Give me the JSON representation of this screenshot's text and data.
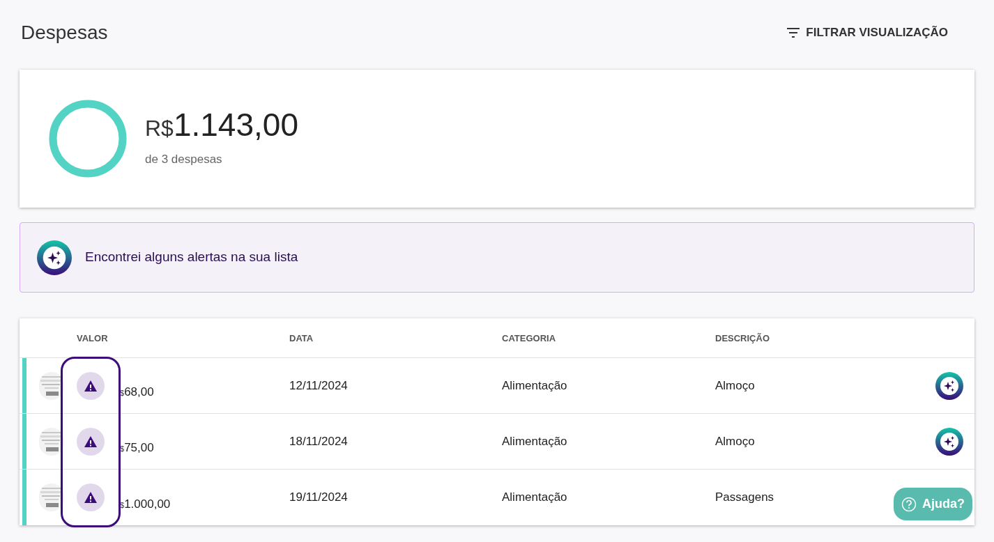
{
  "page": {
    "title": "Despesas",
    "filter_button": "FILTRAR VISUALIZAÇÃO"
  },
  "summary": {
    "currency": "R$",
    "total": "1.143,00",
    "caption": "de 3 despesas"
  },
  "alert_banner": {
    "text": "Encontrei alguns alertas na sua lista"
  },
  "table": {
    "columns": [
      "VALOR",
      "DATA",
      "CATEGORIA",
      "DESCRIÇÃO"
    ],
    "rows": [
      {
        "alert": true,
        "currency": "$",
        "value": "68,00",
        "date": "12/11/2024",
        "category": "Alimentação",
        "description": "Almoço"
      },
      {
        "alert": true,
        "currency": "$",
        "value": "75,00",
        "date": "18/11/2024",
        "category": "Alimentação",
        "description": "Almoço"
      },
      {
        "alert": true,
        "currency": "$",
        "value": "1.000,00",
        "date": "19/11/2024",
        "category": "Alimentação",
        "description": "Passagens"
      }
    ]
  },
  "help_button": "Ajuda?"
}
